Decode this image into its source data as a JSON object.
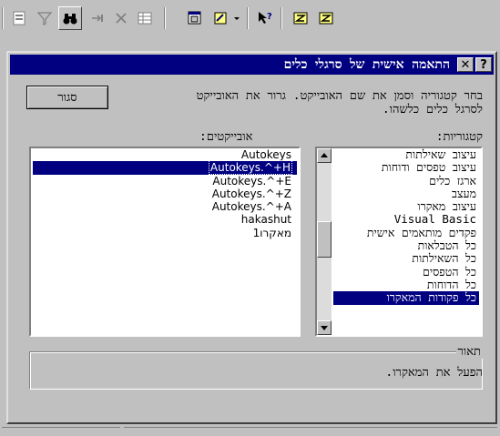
{
  "toolbar": {
    "buttons": [
      "properties-icon",
      "filter-icon",
      "binoculars-icon",
      "next-icon",
      "delete-icon",
      "grid-icon",
      "database-window-icon",
      "new-object-icon",
      "dropdown-arrow-icon",
      "whats-this-icon",
      "build-icon",
      "build-alt-icon"
    ]
  },
  "dialog": {
    "title": "התאמה אישית של סרגלי כלים",
    "help_label": "?",
    "close_label": "✕",
    "instructions": "בחר קטגוריה וסמן את שם האובייקט. גרור את האובייקט לסרגל כלים כלשהו.",
    "close_button": "סגור",
    "categories_label": "קטגוריות:",
    "objects_label": "אובייקטים:",
    "categories": [
      "עיצוב שאילתות",
      "עיצוב טפסים ודוחות",
      "ארגז כלים",
      "מעצב",
      "עיצוב מאקרו",
      "Visual Basic",
      "פקדים מותאמים אישית",
      "כל הטבלאות",
      "כל השאילתות",
      "כל הטפסים",
      "כל הדוחות",
      "כל פקודות המאקרו"
    ],
    "selected_category": "כל פקודות המאקרו",
    "objects": [
      "Autokeys",
      "Autokeys.^+H",
      "Autokeys.^+E",
      "Autokeys.^+Z",
      "Autokeys.^+A",
      "hakashut",
      "מאקרו1"
    ],
    "selected_object": "Autokeys.^+H",
    "description_label": "תאור",
    "description_text": "הפעל את המאקרו."
  },
  "colors": {
    "title_bar": "#000080",
    "face": "#c0c0c0",
    "selection": "#000080"
  }
}
